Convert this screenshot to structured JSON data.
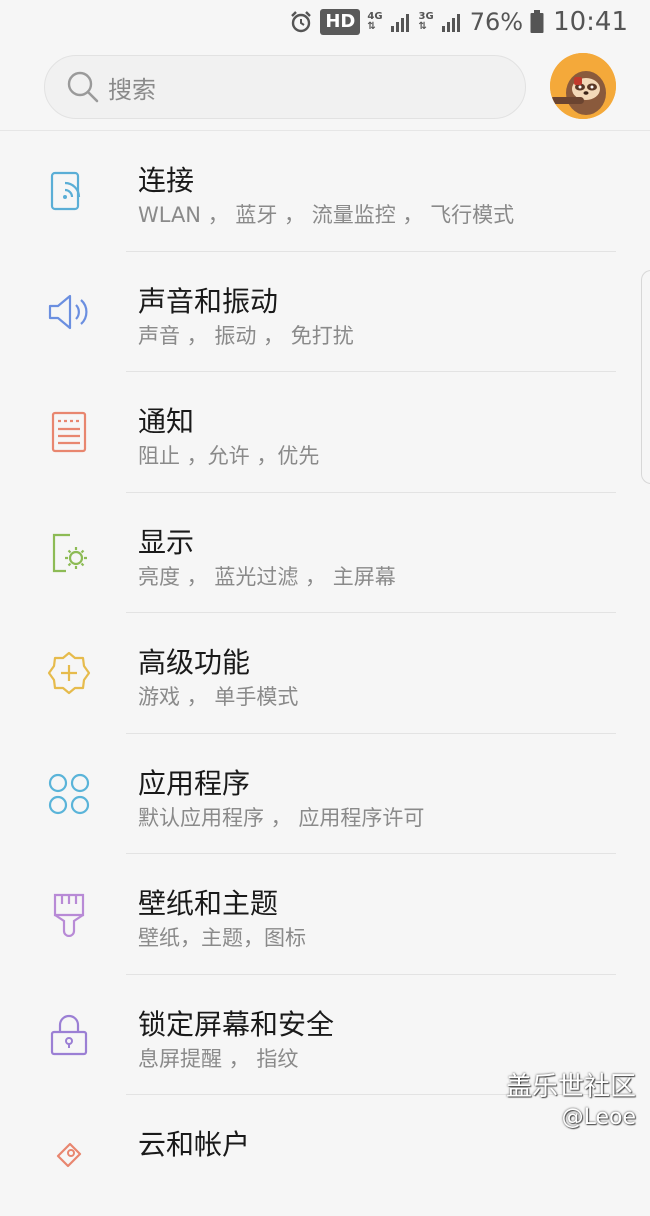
{
  "status_bar": {
    "alarm_icon": "alarm-icon",
    "hd": "HD",
    "net_4g": "4G",
    "net_3g": "3G",
    "battery": "76%",
    "time": "10:41"
  },
  "search": {
    "placeholder": "搜索",
    "icon": "search-icon"
  },
  "avatar": {
    "icon": "sloth-avatar",
    "bg": "#f4a93a"
  },
  "items": [
    {
      "title": "连接",
      "subtitle": "WLAN ， 蓝牙 ， 流量监控 ， 飞行模式",
      "icon": "connection-icon",
      "color": "#5aaed6"
    },
    {
      "title": "声音和振动",
      "subtitle": "声音 ， 振动 ， 免打扰",
      "icon": "speaker-icon",
      "color": "#6b8fe0"
    },
    {
      "title": "通知",
      "subtitle": "阻止 ，允许 ，优先",
      "icon": "notification-icon",
      "color": "#e8866f"
    },
    {
      "title": "显示",
      "subtitle": "亮度 ， 蓝光过滤 ， 主屏幕",
      "icon": "display-icon",
      "color": "#8dbb55"
    },
    {
      "title": "高级功能",
      "subtitle": "游戏 ， 单手模式",
      "icon": "advanced-features-icon",
      "color": "#e6bb4c"
    },
    {
      "title": "应用程序",
      "subtitle": "默认应用程序 ， 应用程序许可",
      "icon": "apps-icon",
      "color": "#5ab4d9"
    },
    {
      "title": "壁纸和主题",
      "subtitle": "壁纸，主题，图标",
      "icon": "paintbrush-icon",
      "color": "#b88ad6"
    },
    {
      "title": "锁定屏幕和安全",
      "subtitle": "息屏提醒 ， 指纹",
      "icon": "lock-icon",
      "color": "#9b7fd4"
    },
    {
      "title": "云和帐户",
      "subtitle": "",
      "icon": "cloud-account-icon",
      "color": "#e8866f"
    }
  ],
  "watermark": {
    "name": "盖乐世社区",
    "user": "@Leoe"
  }
}
